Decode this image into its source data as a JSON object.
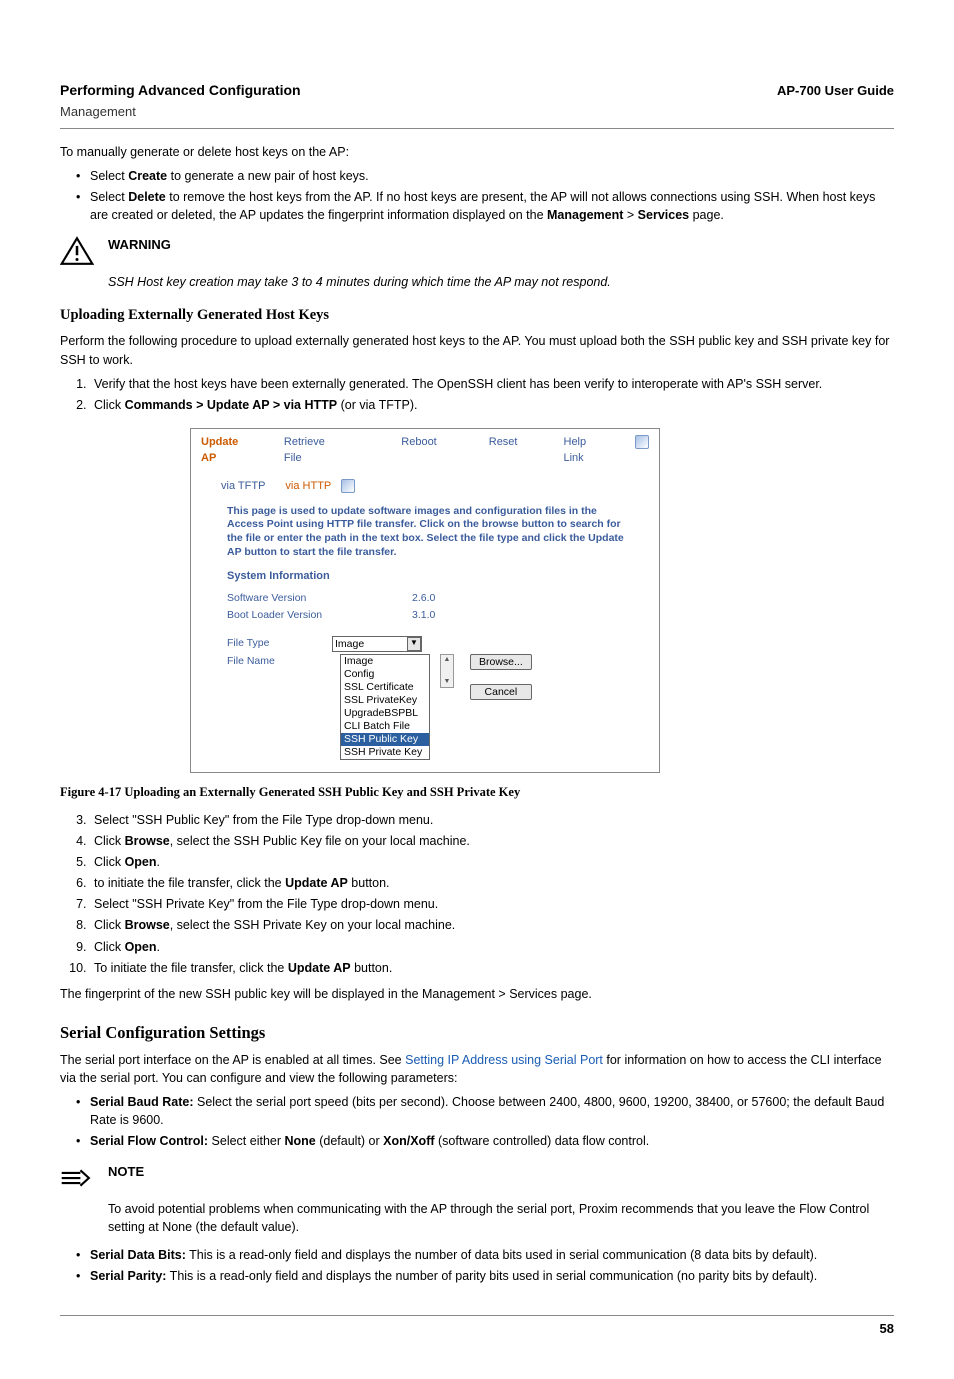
{
  "header": {
    "title_left": "Performing Advanced Configuration",
    "title_right": "AP-700 User Guide",
    "subtitle": "Management"
  },
  "intro": {
    "lead": "To manually generate or delete host keys on the AP:",
    "bul1_pre": "Select ",
    "bul1_b": "Create",
    "bul1_post": " to generate a new pair of host keys.",
    "bul2_pre": "Select ",
    "bul2_b": "Delete",
    "bul2_mid": " to remove the host keys from the AP. If no host keys are present, the AP will not allows connections using SSH. When host keys are created or deleted, the AP updates the fingerprint information displayed on the ",
    "bul2_b2": "Management",
    "bul2_gt": " > ",
    "bul2_b3": "Services",
    "bul2_end": " page."
  },
  "warning": {
    "title": "WARNING",
    "body": "SSH Host key creation may take 3 to 4 minutes during which time the AP may not respond."
  },
  "upload_h": "Uploading Externally Generated Host Keys",
  "upload_p": "Perform the following procedure to upload externally generated host keys to the AP. You must upload both the SSH public key and SSH private key for SSH to work.",
  "ol1": {
    "i1": "Verify that the host keys have been externally generated. The OpenSSH client has been verify to interoperate with AP's SSH server.",
    "i2_pre": "Click ",
    "i2_b": "Commands > Update AP > via HTTP",
    "i2_post": " (or via TFTP)."
  },
  "screenshot": {
    "tabs": [
      "Update AP",
      "Retrieve File",
      "Reboot",
      "Reset",
      "Help Link"
    ],
    "subtabs": [
      "via TFTP",
      "via HTTP"
    ],
    "desc": "This page is used to update software images and configuration files in the Access Point using HTTP file transfer. Click on the browse button to search for the file or enter the path in the text box. Select the file type and click the Update AP button to start the file transfer.",
    "sys_info": "System Information",
    "swv_l": "Software Version",
    "swv_v": "2.6.0",
    "blv_l": "Boot Loader Version",
    "blv_v": "3.1.0",
    "ft_l": "File Type",
    "ft_sel": "Image",
    "fn_l": "File Name",
    "dd": [
      "Image",
      "Config",
      "SSL Certificate",
      "SSL PrivateKey",
      "UpgradeBSPBL",
      "CLI Batch File",
      "SSH Public Key",
      "SSH Private Key"
    ],
    "browse": "Browse...",
    "cancel": "Cancel"
  },
  "fig_cap": "Figure 4-17   Uploading an Externally Generated SSH Public Key and SSH Private Key",
  "ol2": {
    "i3": "Select \"SSH Public Key\" from the File Type drop-down menu.",
    "i4_pre": "Click ",
    "i4_b": "Browse",
    "i4_post": ", select the SSH Public Key file on your local machine.",
    "i5_pre": "Click ",
    "i5_b": "Open",
    "i5_post": ".",
    "i6_pre": "to initiate the file transfer, click the ",
    "i6_b": "Update AP",
    "i6_post": " button.",
    "i7": "Select \"SSH Private Key\" from the File Type drop-down menu.",
    "i8_pre": "Click ",
    "i8_b": "Browse",
    "i8_post": ", select the SSH Private Key on your local machine.",
    "i9_pre": "Click ",
    "i9_b": "Open",
    "i9_post": ".",
    "i10_pre": "To initiate the file transfer, click the ",
    "i10_b": "Update AP",
    "i10_post": " button."
  },
  "fingerprint_p": "The fingerprint of the new SSH public key will be displayed in the Management > Services page.",
  "serial_h": "Serial Configuration Settings",
  "serial_p_pre": "The serial port interface on the AP is enabled at all times. See ",
  "serial_link": "Setting IP Address using Serial Port",
  "serial_p_post": " for information on how to access the CLI interface via the serial port. You can configure and view the following parameters:",
  "serial_bul": {
    "b1_b": "Serial Baud Rate:",
    "b1_t": " Select the serial port speed (bits per second). Choose between 2400, 4800, 9600, 19200, 38400, or 57600; the default Baud Rate is 9600.",
    "b2_b": "Serial Flow Control:",
    "b2_t1": " Select either ",
    "b2_b2": "None",
    "b2_t2": " (default) or ",
    "b2_b3": "Xon/Xoff",
    "b2_t3": " (software controlled) data flow control."
  },
  "note": {
    "title": "NOTE",
    "body": "To avoid potential problems when communicating with the AP through the serial port, Proxim recommends that you leave the Flow Control setting at None (the default value)."
  },
  "serial_bul2": {
    "b3_b": "Serial Data Bits:",
    "b3_t": " This is a read-only field and displays the number of data bits used in serial communication (8 data bits by default).",
    "b4_b": "Serial Parity:",
    "b4_t": " This is a read-only field and displays the number of parity bits used in serial communication (no parity bits by default)."
  },
  "page_num": "58"
}
